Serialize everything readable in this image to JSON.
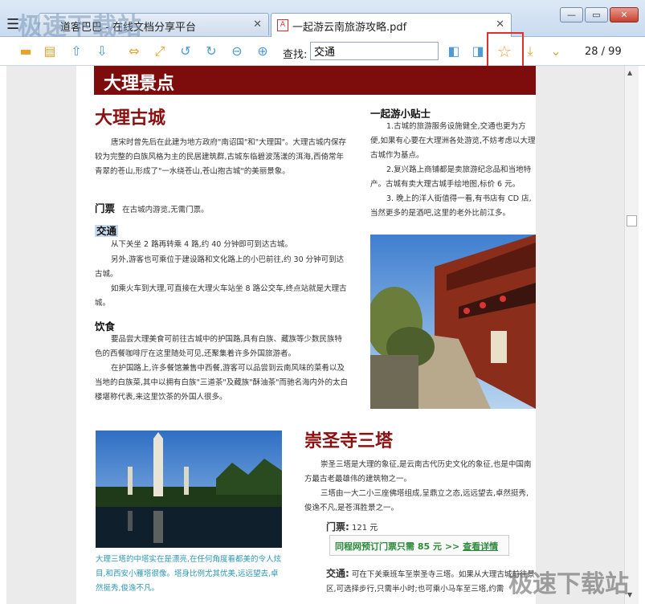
{
  "window": {
    "watermark_top": "极速下载站",
    "watermark_bottom": "极速下载站",
    "menu_glyph": "☰",
    "tabs": [
      {
        "label": "道客巴巴 - 在线文档分享平台",
        "active": false
      },
      {
        "label": "一起游云南旅游攻略.pdf",
        "active": true
      }
    ],
    "controls": {
      "minimize": "—",
      "maximize": "▭",
      "close": "✕"
    }
  },
  "toolbar": {
    "icons": [
      "open-folder-icon",
      "print-icon",
      "page-up-icon",
      "page-down-icon",
      "fit-width-icon",
      "fullscreen-icon",
      "rotate-left-icon",
      "rotate-right-icon",
      "zoom-out-icon",
      "zoom-in-icon"
    ],
    "search_label": "查找:",
    "search_value": "交通",
    "favorite_icon": "star-icon",
    "page_counter": "28 / 99"
  },
  "document": {
    "banner": "大理景点",
    "section1": {
      "title": "大理古城",
      "intro": "唐宋时曾先后在此建为地方政府\"南诏国\"和\"大理国\"。大理古城内保存较为完整的白族风格为主的民居建筑群,古城东临碧波荡漾的洱海,西倚常年青翠的苍山,形成了\"一水绕苍山,苍山抱古城\"的美丽景象。",
      "ticket_head": "门票",
      "ticket_text": "在古城内游览,无需门票。",
      "transport_head": "交通",
      "transport_1": "从下关坐 2 路再转乘 4 路,约 40 分钟即可到达古城。",
      "transport_2": "另外,游客也可乘位于建设路和文化路上的小巴前往,约 30 分钟可到达古城。",
      "transport_3": "如乘火车到大理,可直接在大理火车站坐 8 路公交车,终点站就是大理古城。",
      "food_head": "饮食",
      "food_1": "要品尝大理美食可前往古城中的护国路,具有白族、藏族等少数民族特色的西餐咖啡厅在这里随处可见,还聚集着许多外国旅游者。",
      "food_2": "在护国路上,许多餐馆兼售中西餐,游客可以品尝到云南风味的菜肴以及当地的白族菜,其中以拥有白族\"三道茶\"及藏族\"酥油茶\"而驰名海内外的太白楼堪称代表,来这里饮茶的外国人很多。"
    },
    "tips": {
      "head": "一起游小贴士",
      "tip1": "1.古城的旅游服务设施健全,交通也更为方便,如果有心要在大理洲各处游览,不妨考虑以大理古城作为基点。",
      "tip2": "2.复兴路上商铺都是卖旅游纪念品和当地特产。古城有卖大理古城手绘地图,标价 6 元。",
      "tip3": "3. 晚上的洋人街值得一看,有书店有 CD 店,当然更多的是酒吧,这里的老外比前江多。"
    },
    "section2": {
      "title": "崇圣寺三塔",
      "intro_1": "崇圣三塔是大理的象征,是云南古代历史文化的象征,也是中国南方最古老最雄伟的建筑物之一。",
      "intro_2": "三塔由一大二小三座佛塔组成,呈鼎立之态,远远望去,卓然挺秀,俊逸不凡,是苍洱胜景之一。",
      "ticket_head": "门票:",
      "ticket_price": "121 元",
      "promo": "同程网预订门票只需 85 元",
      "promo_arrow": ">>",
      "promo_link": "查看详情",
      "transport_head": "交通:",
      "transport_1": "可在下关乘班车至崇圣寺三塔。如果从大理古城前往景区,可选择步行,只需半小时;也可乘小马车至三塔,约需",
      "caption": "大理三塔的中塔实在是漂亮,在任何角度看都美的令人炫目,和西安小雁塔很像。塔身比例尤其优美,远远望去,卓然挺秀,俊逸不凡。"
    }
  }
}
